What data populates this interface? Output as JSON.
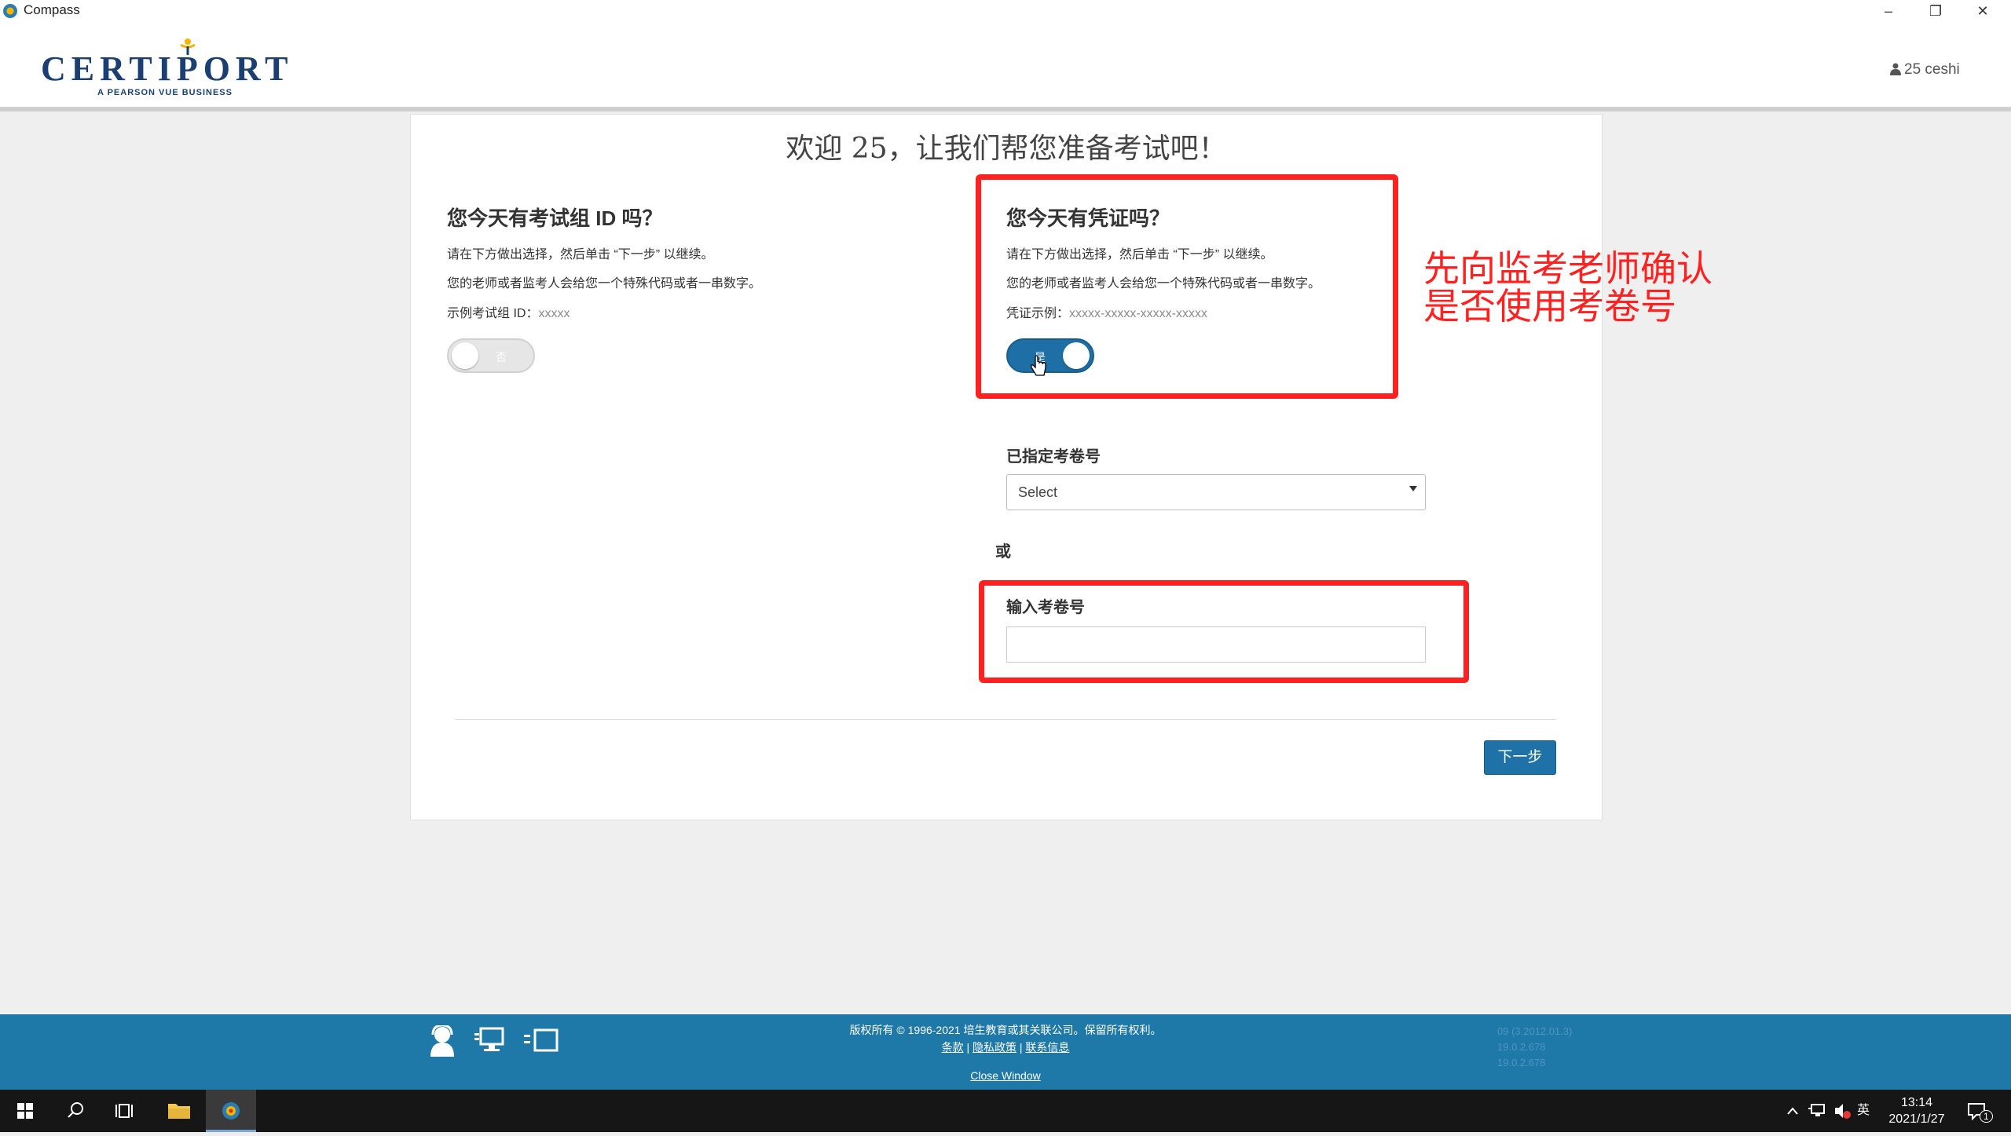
{
  "window": {
    "title": "Compass",
    "min_glyph": "–",
    "max_glyph": "❐",
    "close_glyph": "✕"
  },
  "header": {
    "logo_text": "CERTIPORT",
    "logo_sub": "A PEARSON VUE BUSINESS",
    "user_label": "25 ceshi"
  },
  "main": {
    "welcome": "欢迎 25，让我们帮您准备考试吧！",
    "left": {
      "title": "您今天有考试组 ID 吗？",
      "line1": "请在下方做出选择，然后单击 “下一步” 以继续。",
      "line2": "您的老师或者监考人会给您一个特殊代码或者一串数字。",
      "example_label": "示例考试组 ID：",
      "example_value": "xxxxx",
      "toggle_label": "否"
    },
    "right": {
      "title": "您今天有凭证吗？",
      "line1": "请在下方做出选择，然后单击 “下一步” 以继续。",
      "line2": "您的老师或者监考人会给您一个特殊代码或者一串数字。",
      "example_label": "凭证示例：",
      "example_value": "xxxxx-xxxxx-xxxxx-xxxxx",
      "toggle_label": "是"
    },
    "assigned_label": "已指定考卷号",
    "select_value": "Select",
    "or_text": "或",
    "input_label": "输入考卷号",
    "input_value": "",
    "next_button": "下一步"
  },
  "annotation": {
    "line1": "先向监考老师确认",
    "line2": "是否使用考卷号",
    "color": "#ff2020"
  },
  "footer": {
    "copyright": "版权所有 © 1996-2021 培生教育或其关联公司。保留所有权利。",
    "links": [
      "条款",
      "隐私政策",
      "联系信息"
    ],
    "separator": "|",
    "close_window": "Close Window",
    "versions": [
      "09 (3.2012.01.3)",
      "19.0.2.678",
      "19.0.2.678"
    ]
  },
  "taskbar": {
    "ime": "英",
    "time": "13:14",
    "date": "2021/1/27",
    "notification_count": "1"
  },
  "colors": {
    "brand_blue": "#1e78a8",
    "button_blue": "#1e72a8",
    "annotation_red": "#ff2020"
  }
}
